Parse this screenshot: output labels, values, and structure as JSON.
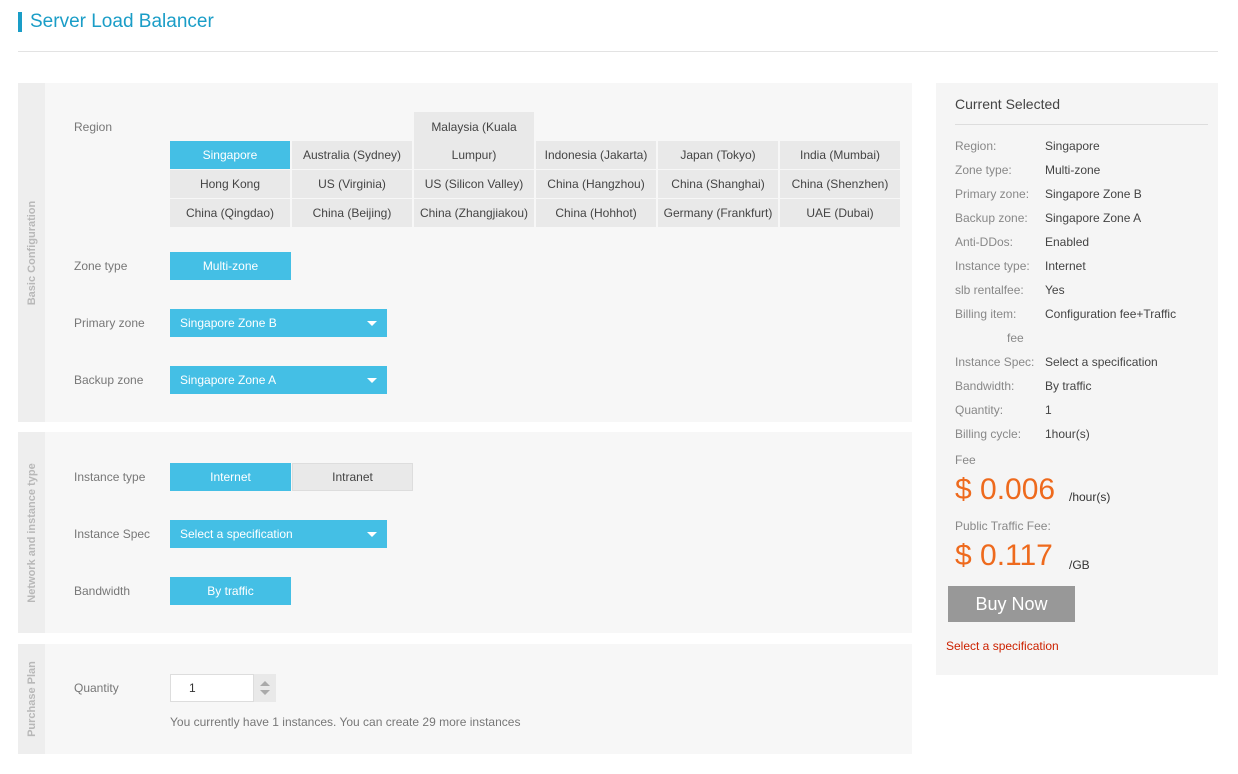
{
  "page": {
    "title": "Server Load Balancer"
  },
  "sections": {
    "basic": "Basic Configuration",
    "network": "Network and instance type",
    "purchase": "Purchase Plan"
  },
  "form": {
    "region_label": "Region",
    "regions": [
      [
        "Singapore",
        "Australia (Sydney)",
        "Malaysia (Kuala Lumpur)",
        "Indonesia (Jakarta)",
        "Japan (Tokyo)",
        "India (Mumbai)"
      ],
      [
        "Hong Kong",
        "US (Virginia)",
        "US (Silicon Valley)",
        "China (Hangzhou)",
        "China (Shanghai)",
        "China (Shenzhen)"
      ],
      [
        "China (Qingdao)",
        "China (Beijing)",
        "China (Zhangjiakou)",
        "China (Hohhot)",
        "Germany (Frankfurt)",
        "UAE (Dubai)"
      ]
    ],
    "region_tall_line1": "Malaysia (Kuala",
    "region_tall_line2": "Lumpur)",
    "selected_region": "Singapore",
    "zone_type_label": "Zone type",
    "zone_type_value": "Multi-zone",
    "primary_zone_label": "Primary zone",
    "primary_zone_value": "Singapore Zone B",
    "backup_zone_label": "Backup zone",
    "backup_zone_value": "Singapore Zone A",
    "instance_type_label": "Instance type",
    "instance_type_options": [
      "Internet",
      "Intranet"
    ],
    "instance_spec_label": "Instance Spec",
    "instance_spec_value": "Select a specification",
    "bandwidth_label": "Bandwidth",
    "bandwidth_value": "By traffic",
    "quantity_label": "Quantity",
    "quantity_value": "1",
    "quantity_hint": "You currently have 1 instances. You can create 29 more instances"
  },
  "summary": {
    "title": "Current Selected",
    "rows": [
      {
        "k": "Region:",
        "v": "Singapore"
      },
      {
        "k": "Zone type:",
        "v": "Multi-zone"
      },
      {
        "k": "Primary zone:",
        "v": "Singapore Zone B"
      },
      {
        "k": "Backup zone:",
        "v": "Singapore Zone A"
      },
      {
        "k": "Anti-DDos:",
        "v": "Enabled"
      },
      {
        "k": "Instance type:",
        "v": "Internet"
      },
      {
        "k": "slb rentalfee:",
        "v": "Yes"
      },
      {
        "k": "Billing item:",
        "v": "Configuration fee+Traffic"
      },
      {
        "k": "Instance Spec:",
        "v": "Select a specification"
      },
      {
        "k": "Bandwidth:",
        "v": "By traffic"
      },
      {
        "k": "Quantity:",
        "v": "1"
      },
      {
        "k": "Billing cycle:",
        "v": "1hour(s)"
      }
    ],
    "billing_item_wrap": "fee",
    "fee_label": "Fee",
    "fee_price": "$ 0.006",
    "fee_unit": "/hour(s)",
    "traffic_label": "Public Traffic Fee:",
    "traffic_price": "$ 0.117",
    "traffic_unit": "/GB",
    "buy_label": "Buy Now",
    "warning": "Select a specification"
  },
  "colors": {
    "accent": "#44bfe5",
    "title": "#1a9dc7",
    "price": "#ee6a1d",
    "warning": "#cc2200"
  }
}
